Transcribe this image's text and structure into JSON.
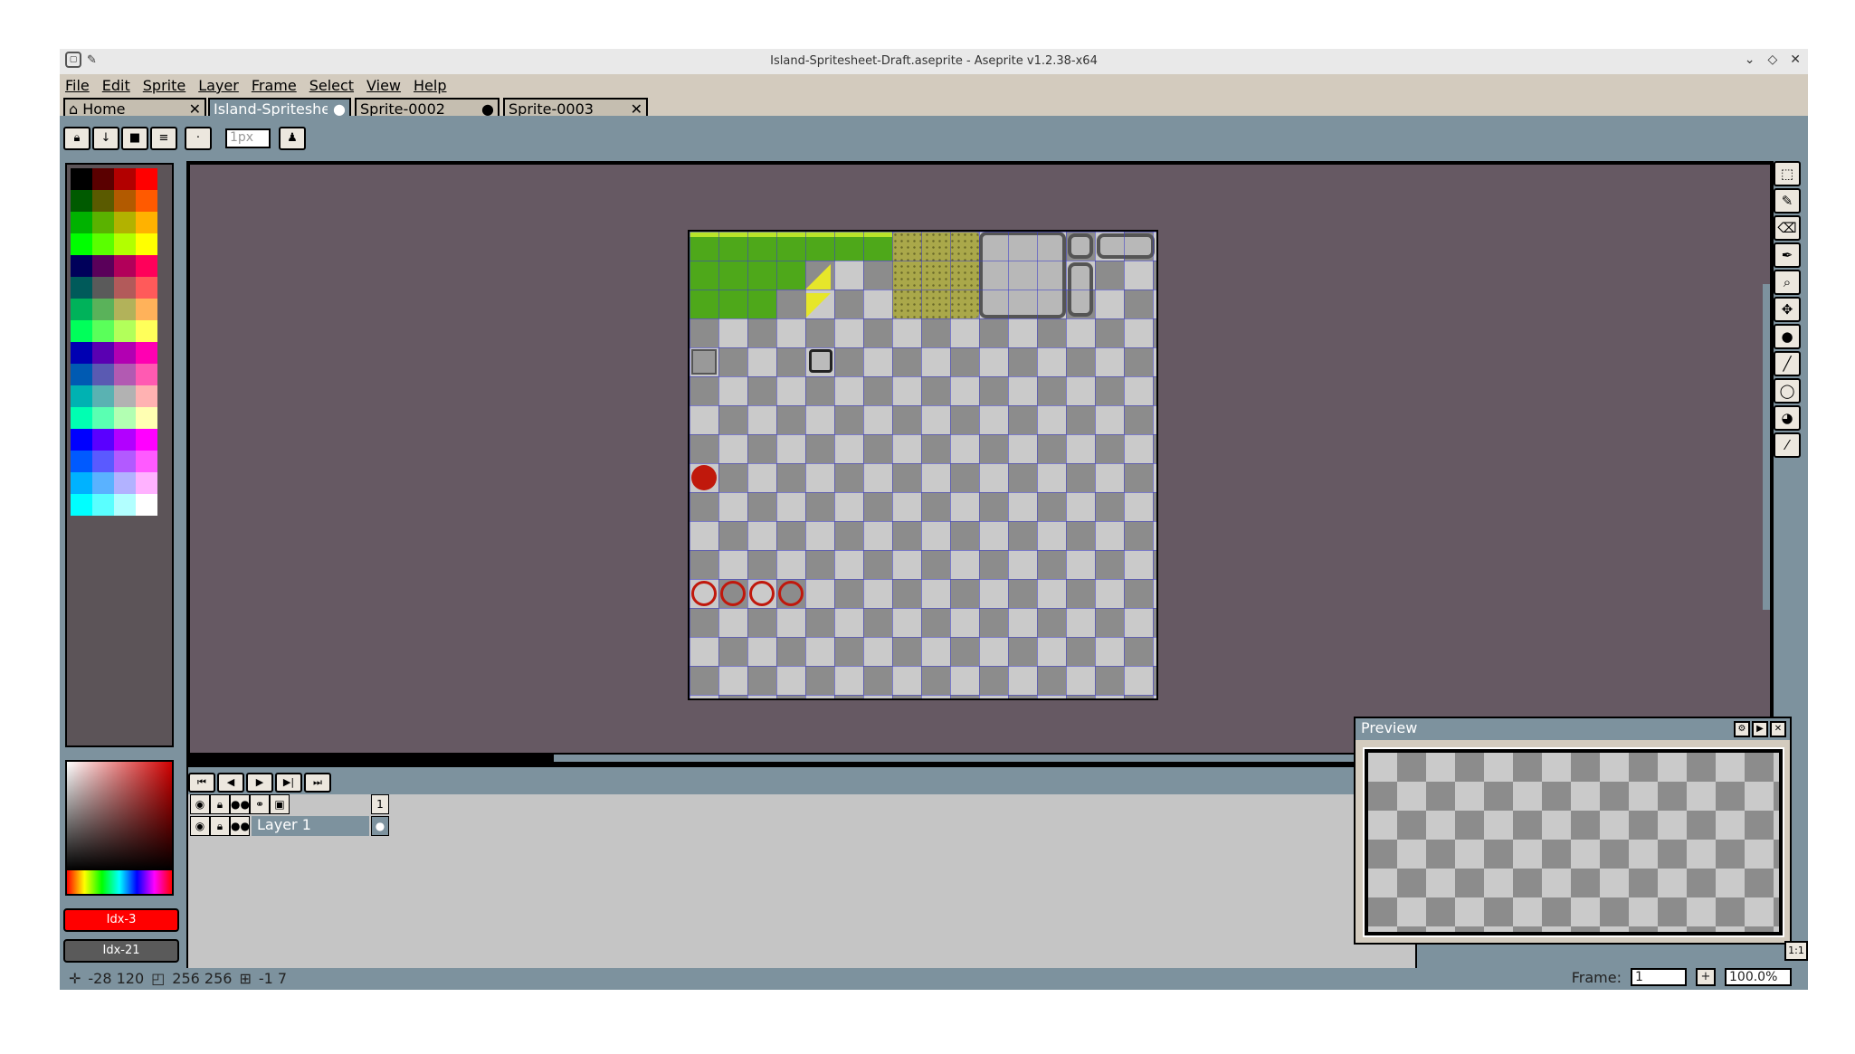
{
  "window": {
    "title": "Island-Spritesheet-Draft.aseprite - Aseprite v1.2.38-x64",
    "controls": [
      "⌄",
      "◇",
      "✕"
    ]
  },
  "menu": [
    "File",
    "Edit",
    "Sprite",
    "Layer",
    "Frame",
    "Select",
    "View",
    "Help"
  ],
  "tabs": [
    {
      "label": "Home",
      "mark": "✕",
      "icon": "home-icon"
    },
    {
      "label": "Island-Spritesheet-Draft",
      "mark": "●",
      "active": true
    },
    {
      "label": "Sprite-0002",
      "mark": "●"
    },
    {
      "label": "Sprite-0003",
      "mark": "✕"
    }
  ],
  "context_bar": {
    "buttons": [
      "lock-icon",
      "down-arrow-icon",
      "square-icon",
      "menu-icon",
      "dot-icon"
    ],
    "brush_size_placeholder": "1px"
  },
  "palette": {
    "colors": [
      "#000000",
      "#5a0000",
      "#b20000",
      "#ff0000",
      "#005a00",
      "#5a5a00",
      "#b25a00",
      "#ff5a00",
      "#00b200",
      "#5ab200",
      "#b2b200",
      "#ffb200",
      "#00ff00",
      "#5aff00",
      "#b2ff00",
      "#ffff00",
      "#00005a",
      "#5a005a",
      "#b2005a",
      "#ff005a",
      "#005a5a",
      "#5a5a5a",
      "#b25a5a",
      "#ff5a5a",
      "#00b25a",
      "#5ab25a",
      "#b2b25a",
      "#ffb25a",
      "#00ff5a",
      "#5aff5a",
      "#b2ff5a",
      "#ffff5a",
      "#0000b2",
      "#5a00b2",
      "#b200b2",
      "#ff00b2",
      "#005ab2",
      "#5a5ab2",
      "#b25ab2",
      "#ff5ab2",
      "#00b2b2",
      "#5ab2b2",
      "#b2b2b2",
      "#ffb2b2",
      "#00ffb2",
      "#5affb2",
      "#b2ffb2",
      "#ffffb2",
      "#0000ff",
      "#5a00ff",
      "#b200ff",
      "#ff00ff",
      "#005aff",
      "#5a5aff",
      "#b25aff",
      "#ff5aff",
      "#00b2ff",
      "#5ab2ff",
      "#b2b2ff",
      "#ffb2ff",
      "#00ffff",
      "#5affff",
      "#b2ffff",
      "#ffffff"
    ]
  },
  "colors": {
    "foreground_label": "Idx-3",
    "foreground_hex": "#ff0000",
    "background_label": "Idx-21",
    "background_hex": "#5a5a5a"
  },
  "tools": [
    "marquee-icon",
    "pencil-icon",
    "eraser-icon",
    "eyedropper-icon",
    "zoom-icon",
    "move-icon",
    "fill-icon",
    "line-icon",
    "ellipse-icon",
    "contour-icon",
    "blur-icon"
  ],
  "timeline": {
    "header_frame": "1",
    "layer_name": "Layer 1"
  },
  "preview": {
    "title": "Preview",
    "zoom_reset": "1:1"
  },
  "status": {
    "cursor": "-28 120",
    "size": "256 256",
    "grid": "-1 7",
    "frame_label": "Frame:",
    "frame_value": "1",
    "zoom_value": "100.0%"
  }
}
